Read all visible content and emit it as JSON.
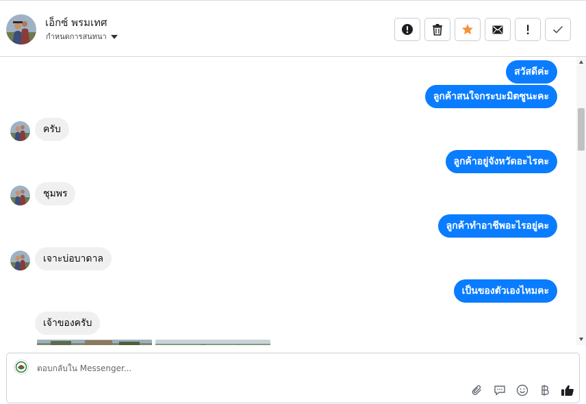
{
  "header": {
    "contact_name": "เอ็กซ์ พรมเทศ",
    "status_label": "กำหนดการสนทนา",
    "actions": [
      {
        "icon": "alert-circle-icon",
        "title": "spam"
      },
      {
        "icon": "trash-icon",
        "title": "delete"
      },
      {
        "icon": "star-icon",
        "title": "star",
        "color": "#f7923a"
      },
      {
        "icon": "envelope-icon",
        "title": "mark-unread"
      },
      {
        "icon": "exclamation-icon",
        "title": "follow-up"
      },
      {
        "icon": "check-icon",
        "title": "done"
      }
    ]
  },
  "messages": [
    {
      "direction": "out",
      "text": "สวัสดีค่ะ"
    },
    {
      "direction": "out",
      "text": "ลูกค้าสนใจกระบะมิตซูนะคะ"
    },
    {
      "direction": "in",
      "text": "ครับ"
    },
    {
      "direction": "out",
      "text": "ลูกค้าอยู่จังหวัดอะไรคะ"
    },
    {
      "direction": "in",
      "text": "ชุมพร"
    },
    {
      "direction": "out",
      "text": "ลูกค้าทำอาชีพอะไรอยู่คะ"
    },
    {
      "direction": "in",
      "text": "เจาะบ่อบาดาล"
    },
    {
      "direction": "out",
      "text": "เป็นของตัวเองไหมคะ"
    },
    {
      "direction": "in",
      "text": "เจ้าของครับ"
    }
  ],
  "composer": {
    "placeholder": "ตอบกลับใน Messenger...",
    "tools": [
      "paperclip-icon",
      "saved-reply-icon",
      "emoji-icon",
      "baht-icon",
      "thumbs-up-icon"
    ]
  },
  "colors": {
    "outgoing_bubble": "#0a7cff",
    "incoming_bubble": "#f0f0f0",
    "star": "#f7923a"
  }
}
